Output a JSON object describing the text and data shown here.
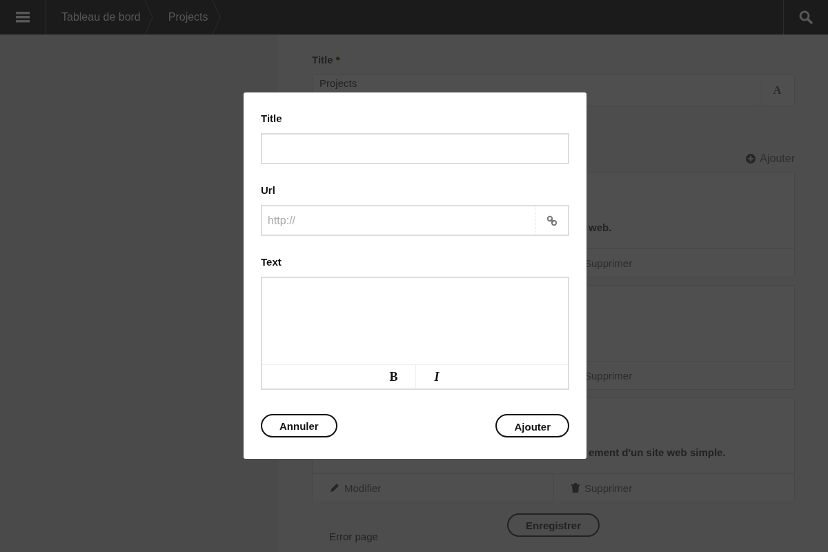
{
  "topbar": {
    "breadcrumbs": [
      "Tableau de bord",
      "Projects"
    ]
  },
  "background": {
    "title_label": "Title",
    "required_mark": "*",
    "title_value": "Projects",
    "title_addon": "A",
    "add_link": "Ajouter",
    "cards": [
      {
        "description": "web.",
        "actions": [
          {
            "kind": "delete",
            "label": "Supprimer"
          }
        ]
      },
      {
        "actions": [
          {
            "kind": "delete",
            "label": "Supprimer"
          }
        ]
      },
      {
        "description": "ement d'un site web simple.",
        "actions": [
          {
            "kind": "edit",
            "label": "Modifier"
          },
          {
            "kind": "delete",
            "label": "Supprimer"
          }
        ]
      }
    ],
    "save_button": "Enregistrer",
    "next_section": "Error page"
  },
  "modal": {
    "fields": [
      {
        "kind": "text",
        "label": "Title"
      },
      {
        "kind": "url",
        "label": "Url",
        "placeholder": "http://"
      },
      {
        "kind": "textarea",
        "label": "Text",
        "toolbar": [
          "B",
          "I"
        ]
      }
    ],
    "buttons": [
      {
        "kind": "cancel",
        "label": "Annuler"
      },
      {
        "kind": "submit",
        "label": "Ajouter"
      }
    ]
  }
}
